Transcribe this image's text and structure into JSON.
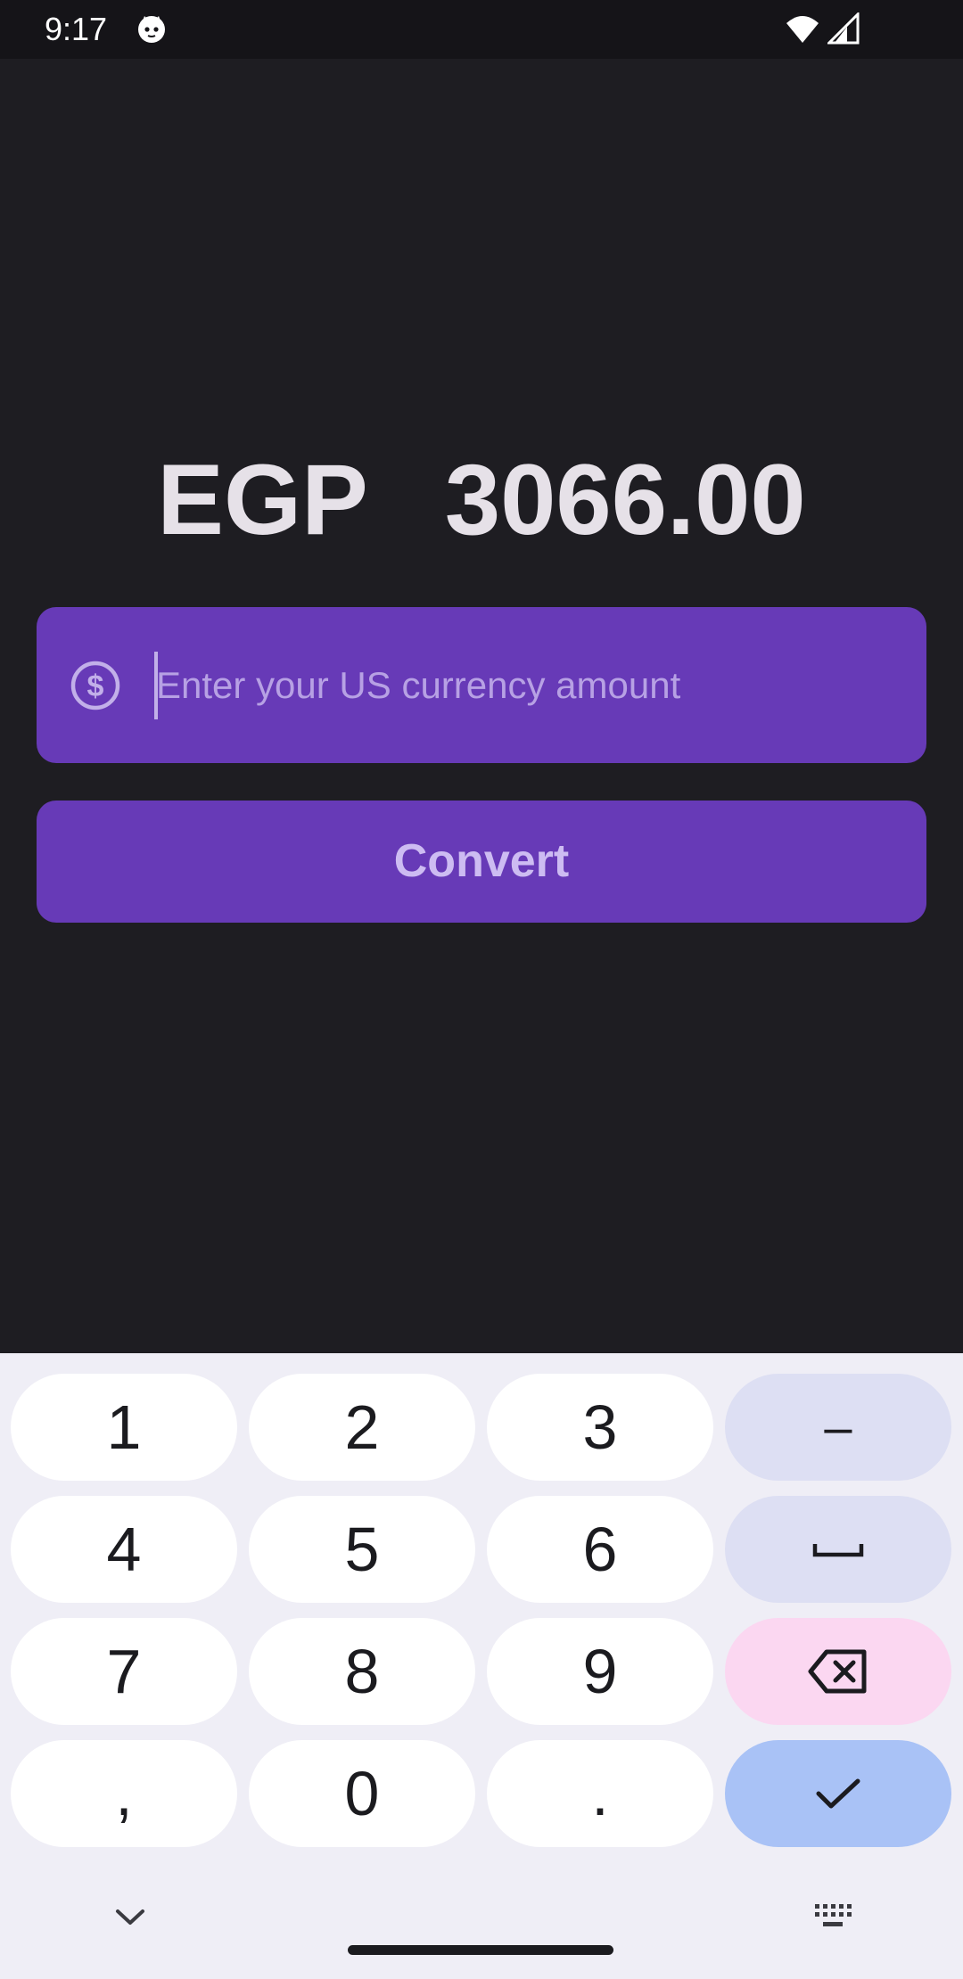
{
  "status_bar": {
    "time": "9:17",
    "icons": [
      "cat-face-icon",
      "wifi-icon",
      "cell-signal-icon"
    ]
  },
  "result": {
    "currency": "EGP",
    "amount": "3066.00"
  },
  "input": {
    "placeholder": "Enter your US currency amount",
    "value": "",
    "leading_icon": "dollar-circle-icon"
  },
  "convert_button": {
    "label": "Convert"
  },
  "keyboard": {
    "rows": [
      [
        "1",
        "2",
        "3",
        "–"
      ],
      [
        "4",
        "5",
        "6",
        "space"
      ],
      [
        "7",
        "8",
        "9",
        "backspace"
      ],
      [
        ",",
        "0",
        ".",
        "done"
      ]
    ],
    "bottom_icons": [
      "chevron-down-icon",
      "keyboard-icon"
    ]
  },
  "colors": {
    "background": "#1e1d22",
    "accent": "#673ab7",
    "result_text": "#e6e1e8",
    "keyboard_bg": "#efeef6",
    "func_key": "#dddff3",
    "delete_key": "#fbd7f1",
    "done_key": "#a9c2f6"
  }
}
